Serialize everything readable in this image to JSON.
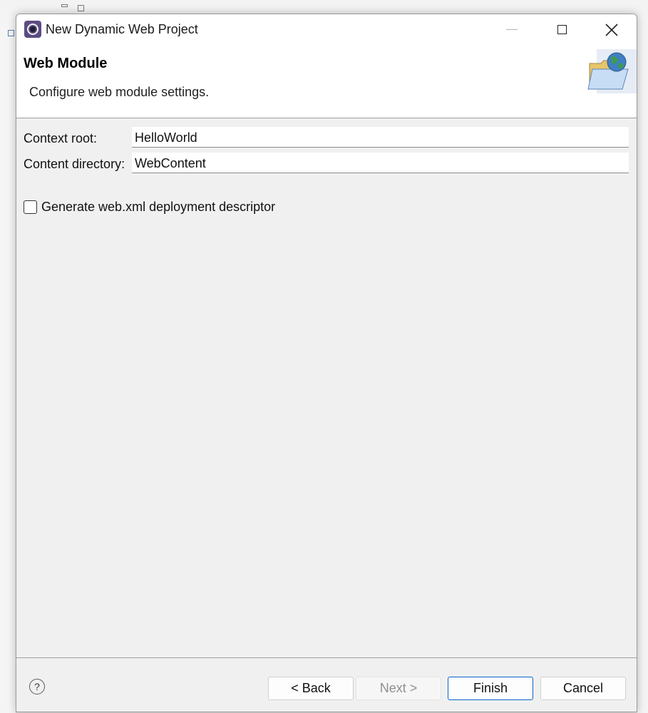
{
  "window": {
    "title": "New Dynamic Web Project"
  },
  "banner": {
    "title": "Web Module",
    "description": "Configure web module settings."
  },
  "form": {
    "context_root_label": "Context root:",
    "context_root_value": "HelloWorld",
    "content_dir_label": "Content directory:",
    "content_dir_value": "WebContent",
    "generate_xml_label": "Generate web.xml deployment descriptor",
    "generate_xml_checked": false
  },
  "buttons": {
    "help": "?",
    "back": "< Back",
    "next": "Next >",
    "finish": "Finish",
    "cancel": "Cancel"
  },
  "colors": {
    "accent": "#0a64c9",
    "dialog_bg": "#f0f0f0",
    "banner_bg": "#ffffff"
  },
  "icons": {
    "app": "eclipse-icon",
    "banner": "web-folder-globe-icon"
  }
}
